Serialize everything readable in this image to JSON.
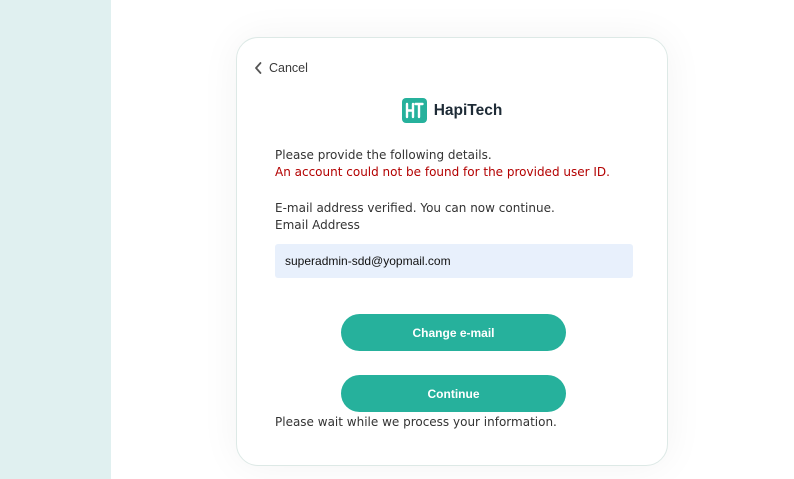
{
  "nav": {
    "cancel_label": "Cancel"
  },
  "brand": {
    "name": "HapiTech",
    "logo_letters": "HT",
    "color": "#26b19c"
  },
  "form": {
    "intro": "Please provide the following details.",
    "error": "An account could not be found for the provided user ID.",
    "verified_msg": "E-mail address verified. You can now continue.",
    "email_label": "Email Address",
    "email_value": "superadmin-sdd@yopmail.com",
    "change_email_label": "Change e-mail",
    "continue_label": "Continue",
    "wait_msg": "Please wait while we process your information."
  },
  "colors": {
    "accent": "#26b19c",
    "error": "#b30000",
    "side_panel": "#e0f0f0",
    "input_bg": "#e8f0fc"
  }
}
